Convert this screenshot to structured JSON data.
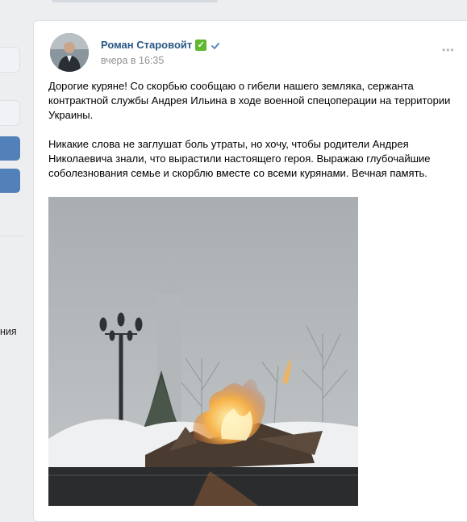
{
  "sidebar": {
    "partial_text": "ния"
  },
  "post": {
    "author": "Роман Старовойт",
    "author_badge": "✅",
    "date": "вчера в 16:35",
    "more": "•••",
    "text": "Дорогие куряне! Со скорбью сообщаю о гибели нашего земляка, сержанта контрактной службы Андрея Ильина в ходе военной спецоперации на территории Украины.\n\nНикакие слова не заглушат боль утраты, но хочу, чтобы родители Андрея Николаевича знали, что вырастили настоящего героя. Выражаю глубочайшие соболезнования семье и скорблю вместе со всеми курянами. Вечная память."
  },
  "colors": {
    "link": "#2a5885",
    "accent": "#5181b8",
    "background": "#edeef0"
  },
  "icons": [
    "verified-check-icon",
    "more-dots-icon",
    "green-check-emoji-icon"
  ]
}
